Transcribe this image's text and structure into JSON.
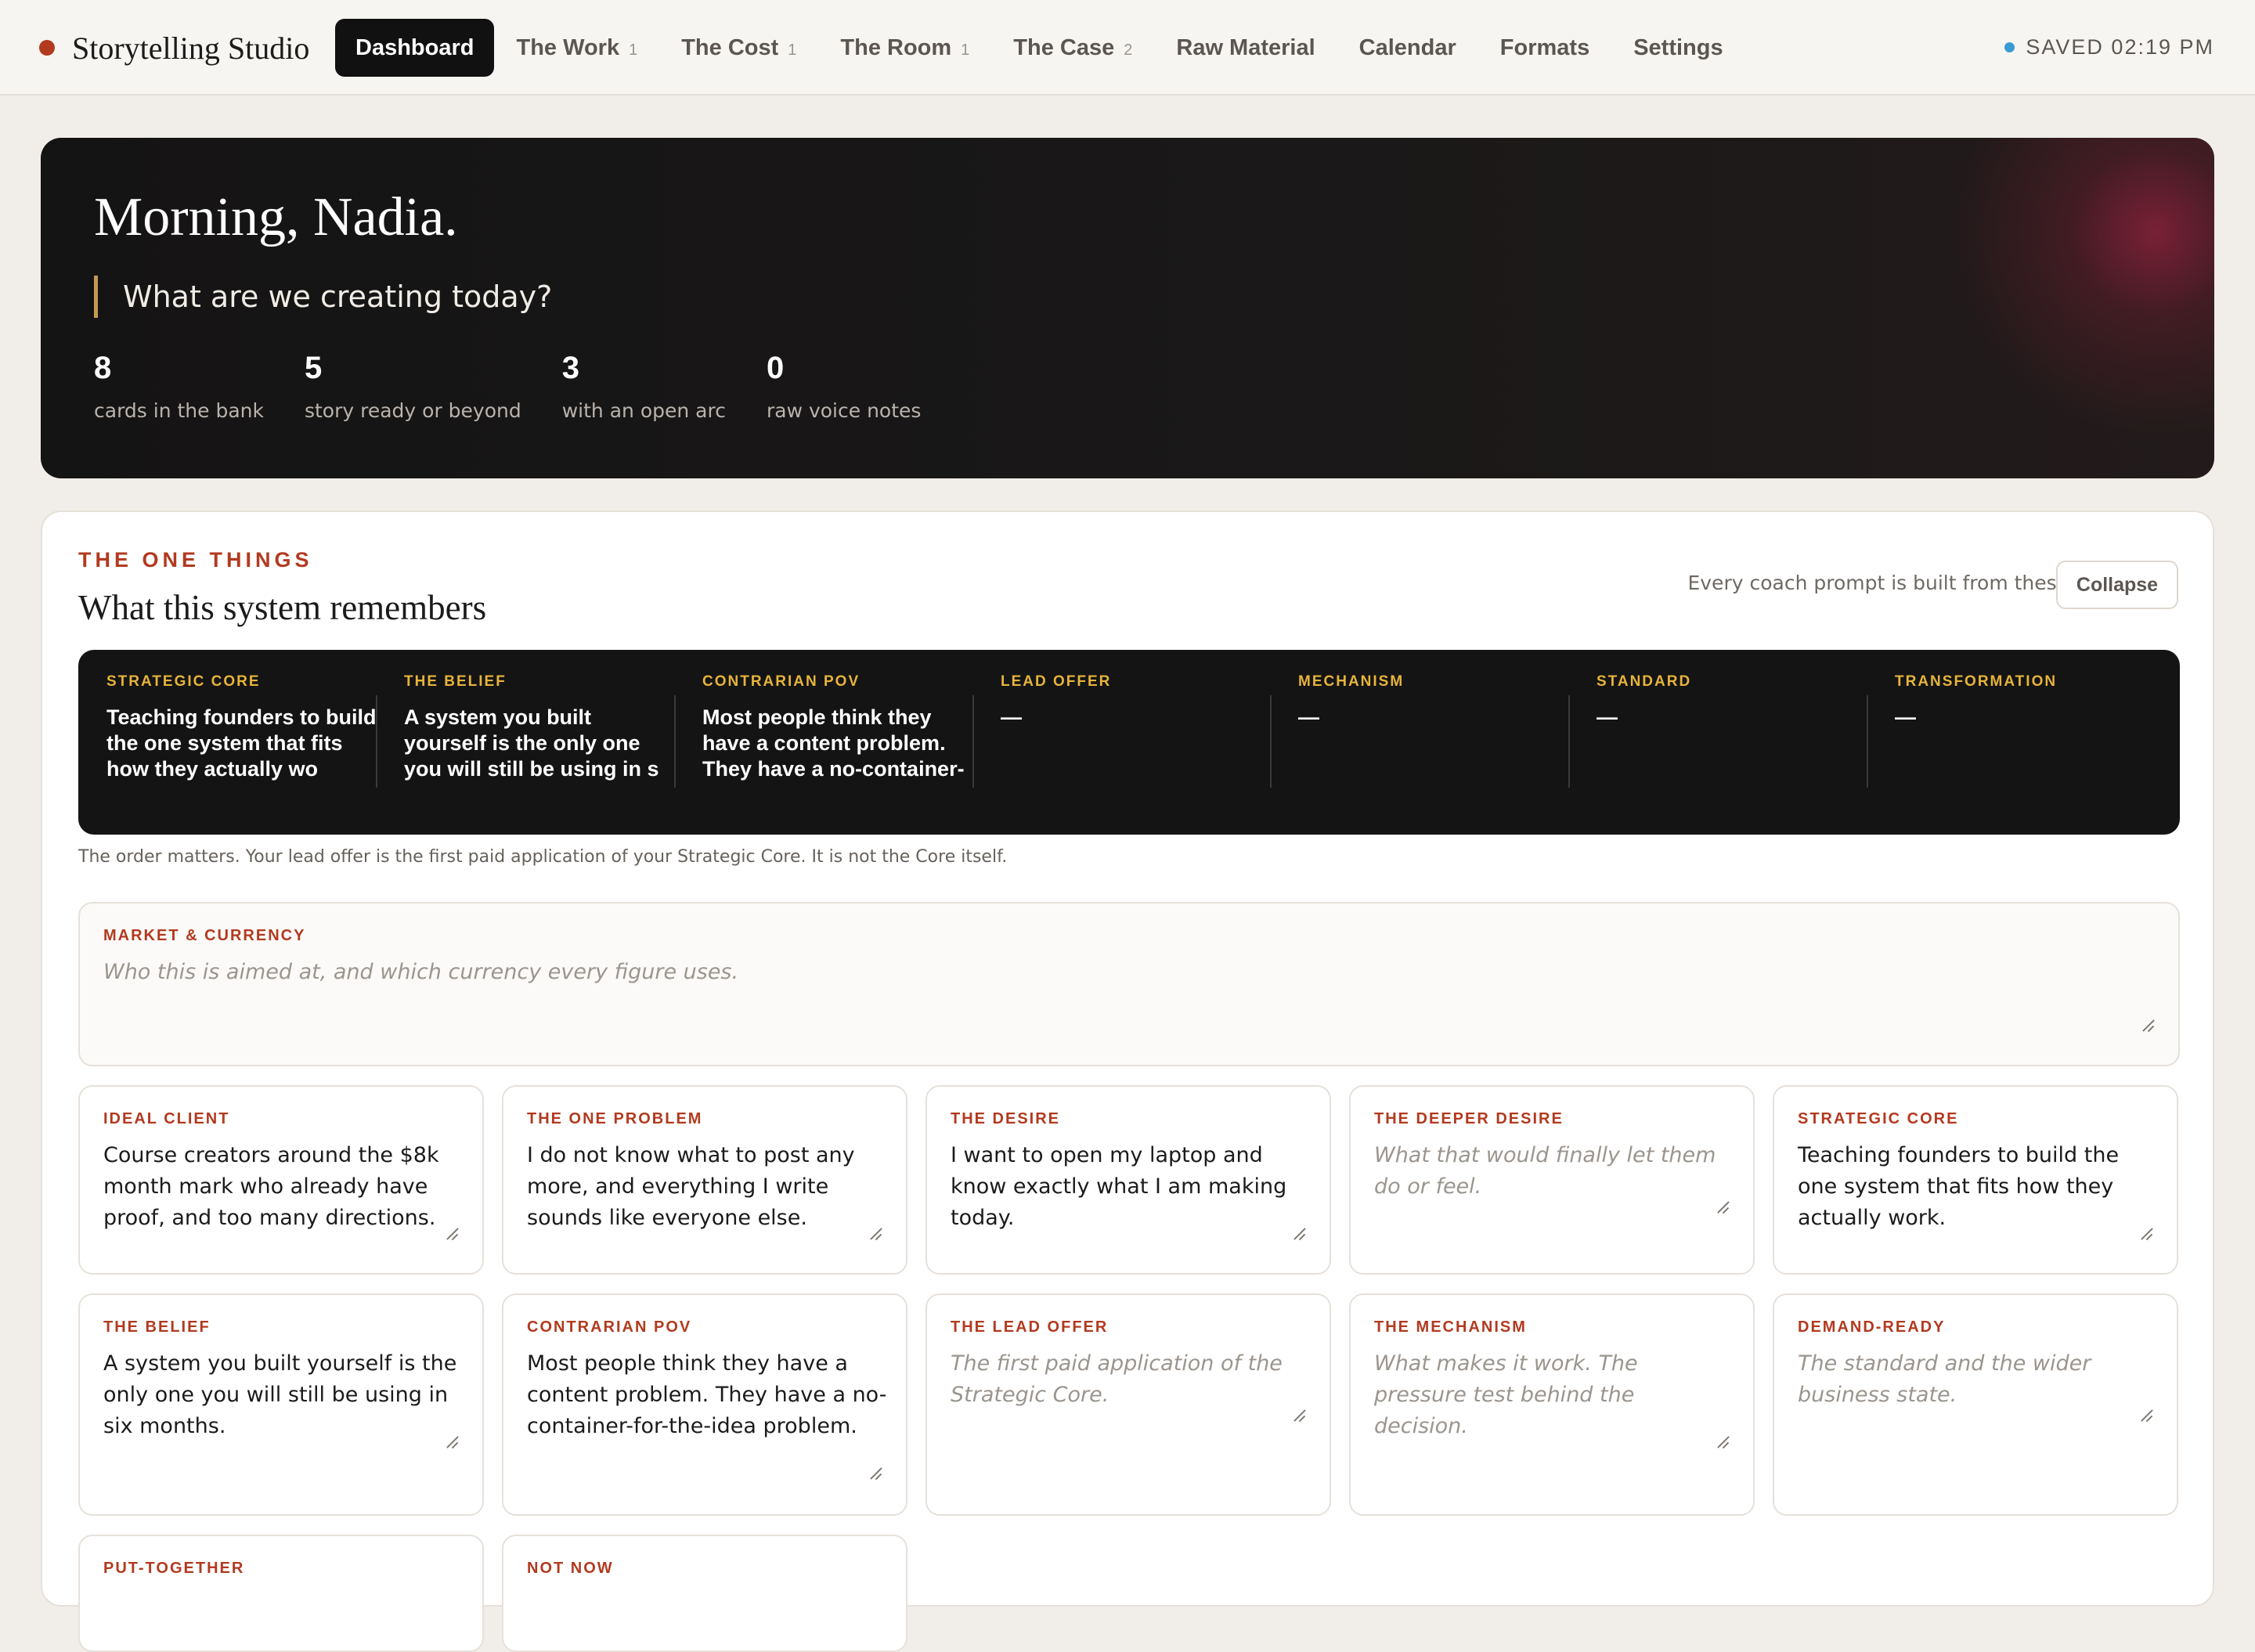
{
  "app": {
    "name": "Storytelling Studio"
  },
  "nav": {
    "tabs": [
      {
        "label": "Dashboard",
        "count": ""
      },
      {
        "label": "The Work",
        "count": "1"
      },
      {
        "label": "The Cost",
        "count": "1"
      },
      {
        "label": "The Room",
        "count": "1"
      },
      {
        "label": "The Case",
        "count": "2"
      },
      {
        "label": "Raw Material",
        "count": ""
      },
      {
        "label": "Calendar",
        "count": ""
      },
      {
        "label": "Formats",
        "count": ""
      },
      {
        "label": "Settings",
        "count": ""
      }
    ],
    "saved": "SAVED 02:19 PM"
  },
  "hero": {
    "greeting": "Morning, Nadia.",
    "question": "What are we creating today?",
    "stats": [
      {
        "value": "8",
        "label": "cards in the bank"
      },
      {
        "value": "5",
        "label": "story ready or beyond"
      },
      {
        "value": "3",
        "label": "with an open arc"
      },
      {
        "value": "0",
        "label": "raw voice notes"
      }
    ]
  },
  "one_things": {
    "eyebrow": "THE ONE THINGS",
    "title": "What this system remembers",
    "hint": "Every coach prompt is built from these.",
    "collapse_label": "Collapse",
    "strip": [
      {
        "label": "STRATEGIC CORE",
        "value": "Teaching founders to build the one system that fits how they actually wo"
      },
      {
        "label": "THE BELIEF",
        "value": "A system you built yourself is the only one you will still be using in s"
      },
      {
        "label": "CONTRARIAN POV",
        "value": "Most people think they have a content problem. They have a no-container-"
      },
      {
        "label": "LEAD OFFER",
        "value": "—"
      },
      {
        "label": "MECHANISM",
        "value": "—"
      },
      {
        "label": "STANDARD",
        "value": "—"
      },
      {
        "label": "TRANSFORMATION",
        "value": "—"
      }
    ],
    "order_note": "The order matters. Your lead offer is the first paid application of your Strategic Core. It is not the Core itself.",
    "market": {
      "label": "MARKET & CURRENCY",
      "placeholder": "Who this is aimed at, and which currency every figure uses.",
      "value": ""
    },
    "fields": [
      {
        "label": "IDEAL CLIENT",
        "value": "Course creators around the $8k month mark who already have proof, and too many directions.",
        "placeholder": ""
      },
      {
        "label": "THE ONE PROBLEM",
        "value": "I do not know what to post any more, and everything I write sounds like everyone else.",
        "placeholder": ""
      },
      {
        "label": "THE DESIRE",
        "value": "I want to open my laptop and know exactly what I am making today.",
        "placeholder": ""
      },
      {
        "label": "THE DEEPER DESIRE",
        "value": "",
        "placeholder": "What that would finally let them do or feel."
      },
      {
        "label": "STRATEGIC CORE",
        "value": "Teaching founders to build the one system that fits how they actually work.",
        "placeholder": ""
      },
      {
        "label": "THE BELIEF",
        "value": "A system you built yourself is the only one you will still be using in six months.",
        "placeholder": ""
      },
      {
        "label": "CONTRARIAN POV",
        "value": "Most people think they have a content problem. They have a no-container-for-the-idea problem.",
        "placeholder": ""
      },
      {
        "label": "THE LEAD OFFER",
        "value": "",
        "placeholder": "The first paid application of the Strategic Core."
      },
      {
        "label": "THE MECHANISM",
        "value": "",
        "placeholder": "What makes it work. The pressure test behind the decision."
      },
      {
        "label": "DEMAND-READY",
        "value": "",
        "placeholder": "The standard and the wider business state."
      },
      {
        "label": "PUT-TOGETHER",
        "value": "",
        "placeholder": ""
      },
      {
        "label": "NOT NOW",
        "value": "",
        "placeholder": ""
      }
    ]
  },
  "colors": {
    "accent": "#b23a1f",
    "gold": "#e7b43a",
    "saved_dot": "#3a9bd3"
  },
  "icons": {
    "brand": "brand-dot-icon",
    "saved": "status-dot-icon",
    "resize": "resize-grip-icon"
  }
}
